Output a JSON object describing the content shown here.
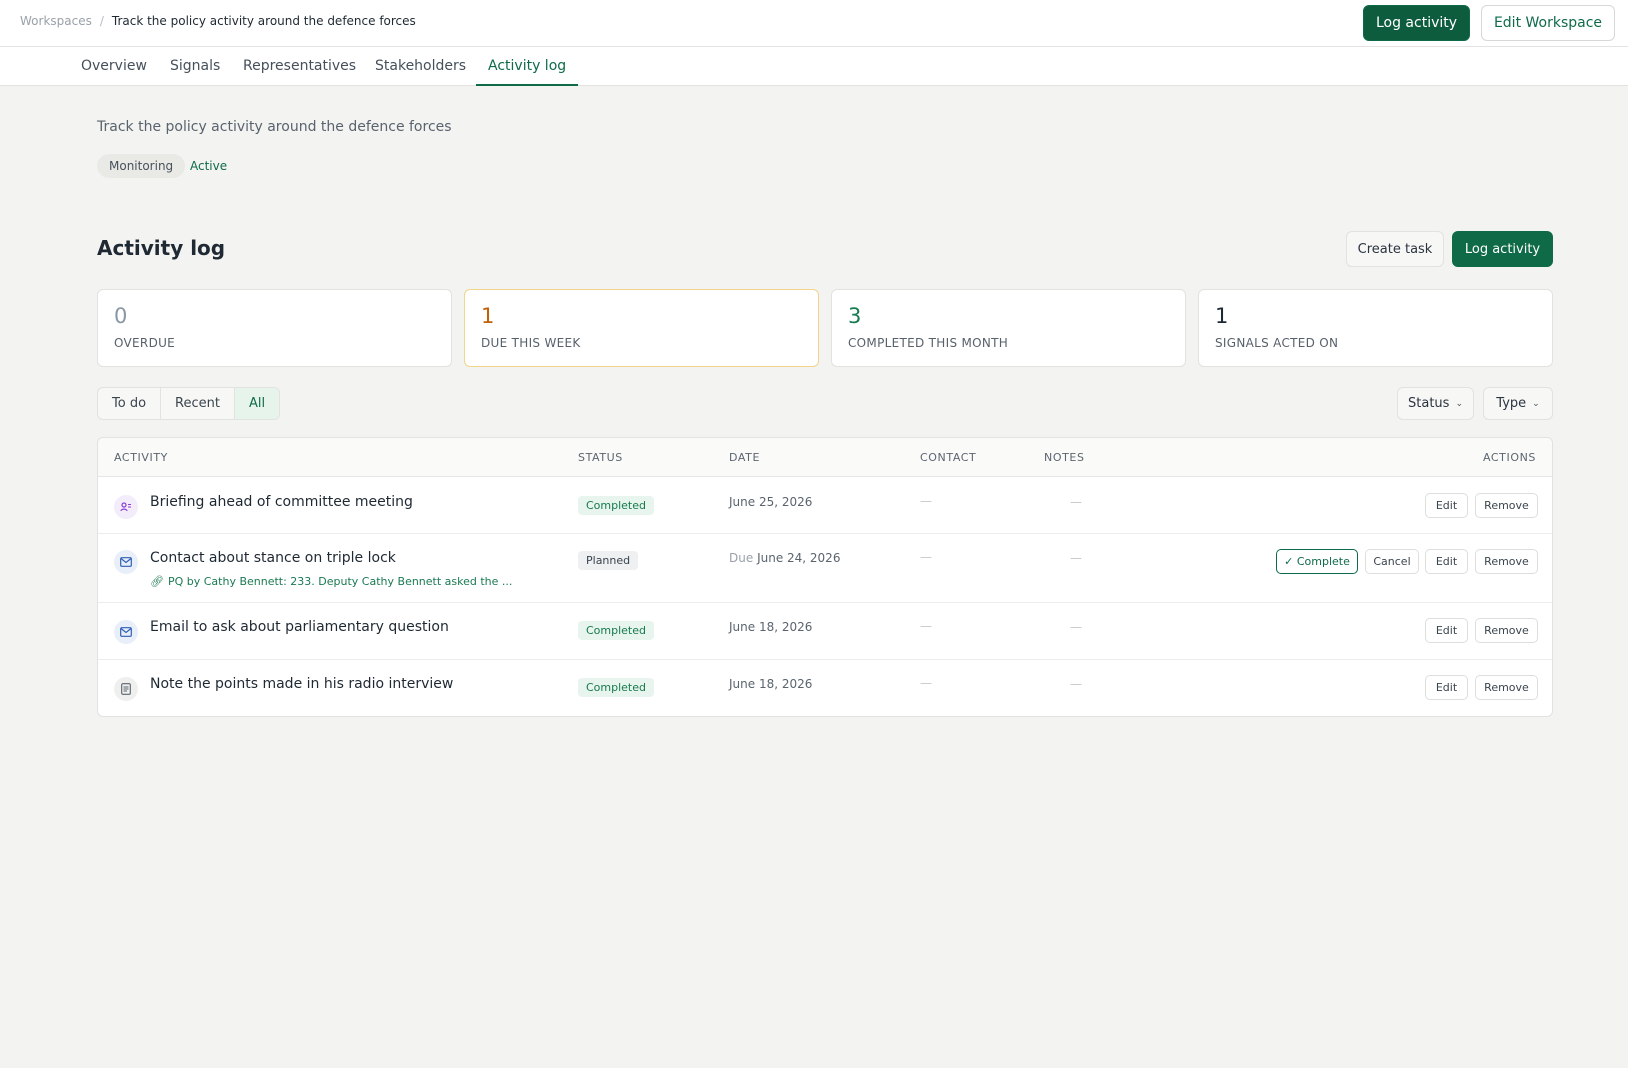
{
  "header": {
    "breadcrumb_root": "Workspaces",
    "breadcrumb_sep": "/",
    "breadcrumb_current": "Track the policy activity around the defence forces",
    "log_activity_label": "Log activity",
    "edit_workspace_label": "Edit Workspace"
  },
  "tabs": [
    {
      "label": "Overview",
      "active": false
    },
    {
      "label": "Signals",
      "active": false
    },
    {
      "label": "Representatives",
      "active": false
    },
    {
      "label": "Stakeholders",
      "active": false
    },
    {
      "label": "Activity log",
      "active": true
    }
  ],
  "workspace": {
    "description": "Track the policy activity around the defence forces",
    "tags": [
      "Monitoring",
      "Active"
    ]
  },
  "section": {
    "title": "Activity log",
    "create_task_label": "Create task",
    "log_activity_label": "Log activity"
  },
  "stats": [
    {
      "value": "0",
      "label": "OVERDUE",
      "color": "#8a96a3"
    },
    {
      "value": "1",
      "label": "DUE THIS WEEK",
      "color": "#c2600a",
      "highlight": "#f2d48a"
    },
    {
      "value": "3",
      "label": "COMPLETED THIS MONTH",
      "color": "#157a4d"
    },
    {
      "value": "1",
      "label": "SIGNALS ACTED ON",
      "color": "#1f2933"
    }
  ],
  "filters": {
    "segments": [
      "To do",
      "Recent",
      "All"
    ],
    "active_segment": "All",
    "status_label": "Status",
    "type_label": "Type"
  },
  "table": {
    "columns": [
      "ACTIVITY",
      "STATUS",
      "DATE",
      "CONTACT",
      "NOTES",
      "ACTIONS"
    ],
    "rows": [
      {
        "icon": "meeting-icon",
        "title": "Briefing ahead of committee meeting",
        "status": "Completed",
        "date": "June 25, 2026",
        "contact": "—",
        "notes": "—",
        "actions": [
          "Edit",
          "Remove"
        ]
      },
      {
        "icon": "email-icon",
        "title": "Contact about stance on triple lock",
        "link": "PQ by Cathy Bennett: 233. Deputy Cathy Bennett asked the ...",
        "status": "Planned",
        "date_prefix": "Due",
        "date": "June 24, 2026",
        "contact": "—",
        "notes": "—",
        "actions": [
          "✓ Complete",
          "Cancel",
          "Edit",
          "Remove"
        ]
      },
      {
        "icon": "email-icon",
        "title": "Email to ask about parliamentary question",
        "status": "Completed",
        "date": "June 18, 2026",
        "contact": "—",
        "notes": "—",
        "actions": [
          "Edit",
          "Remove"
        ]
      },
      {
        "icon": "note-icon",
        "title": "Note the points made in his radio interview",
        "status": "Completed",
        "date": "June 18, 2026",
        "contact": "—",
        "notes": "—",
        "actions": [
          "Edit",
          "Remove"
        ]
      }
    ]
  },
  "colors": {
    "brand": "#0f6b47",
    "background": "#f3f3f1"
  }
}
